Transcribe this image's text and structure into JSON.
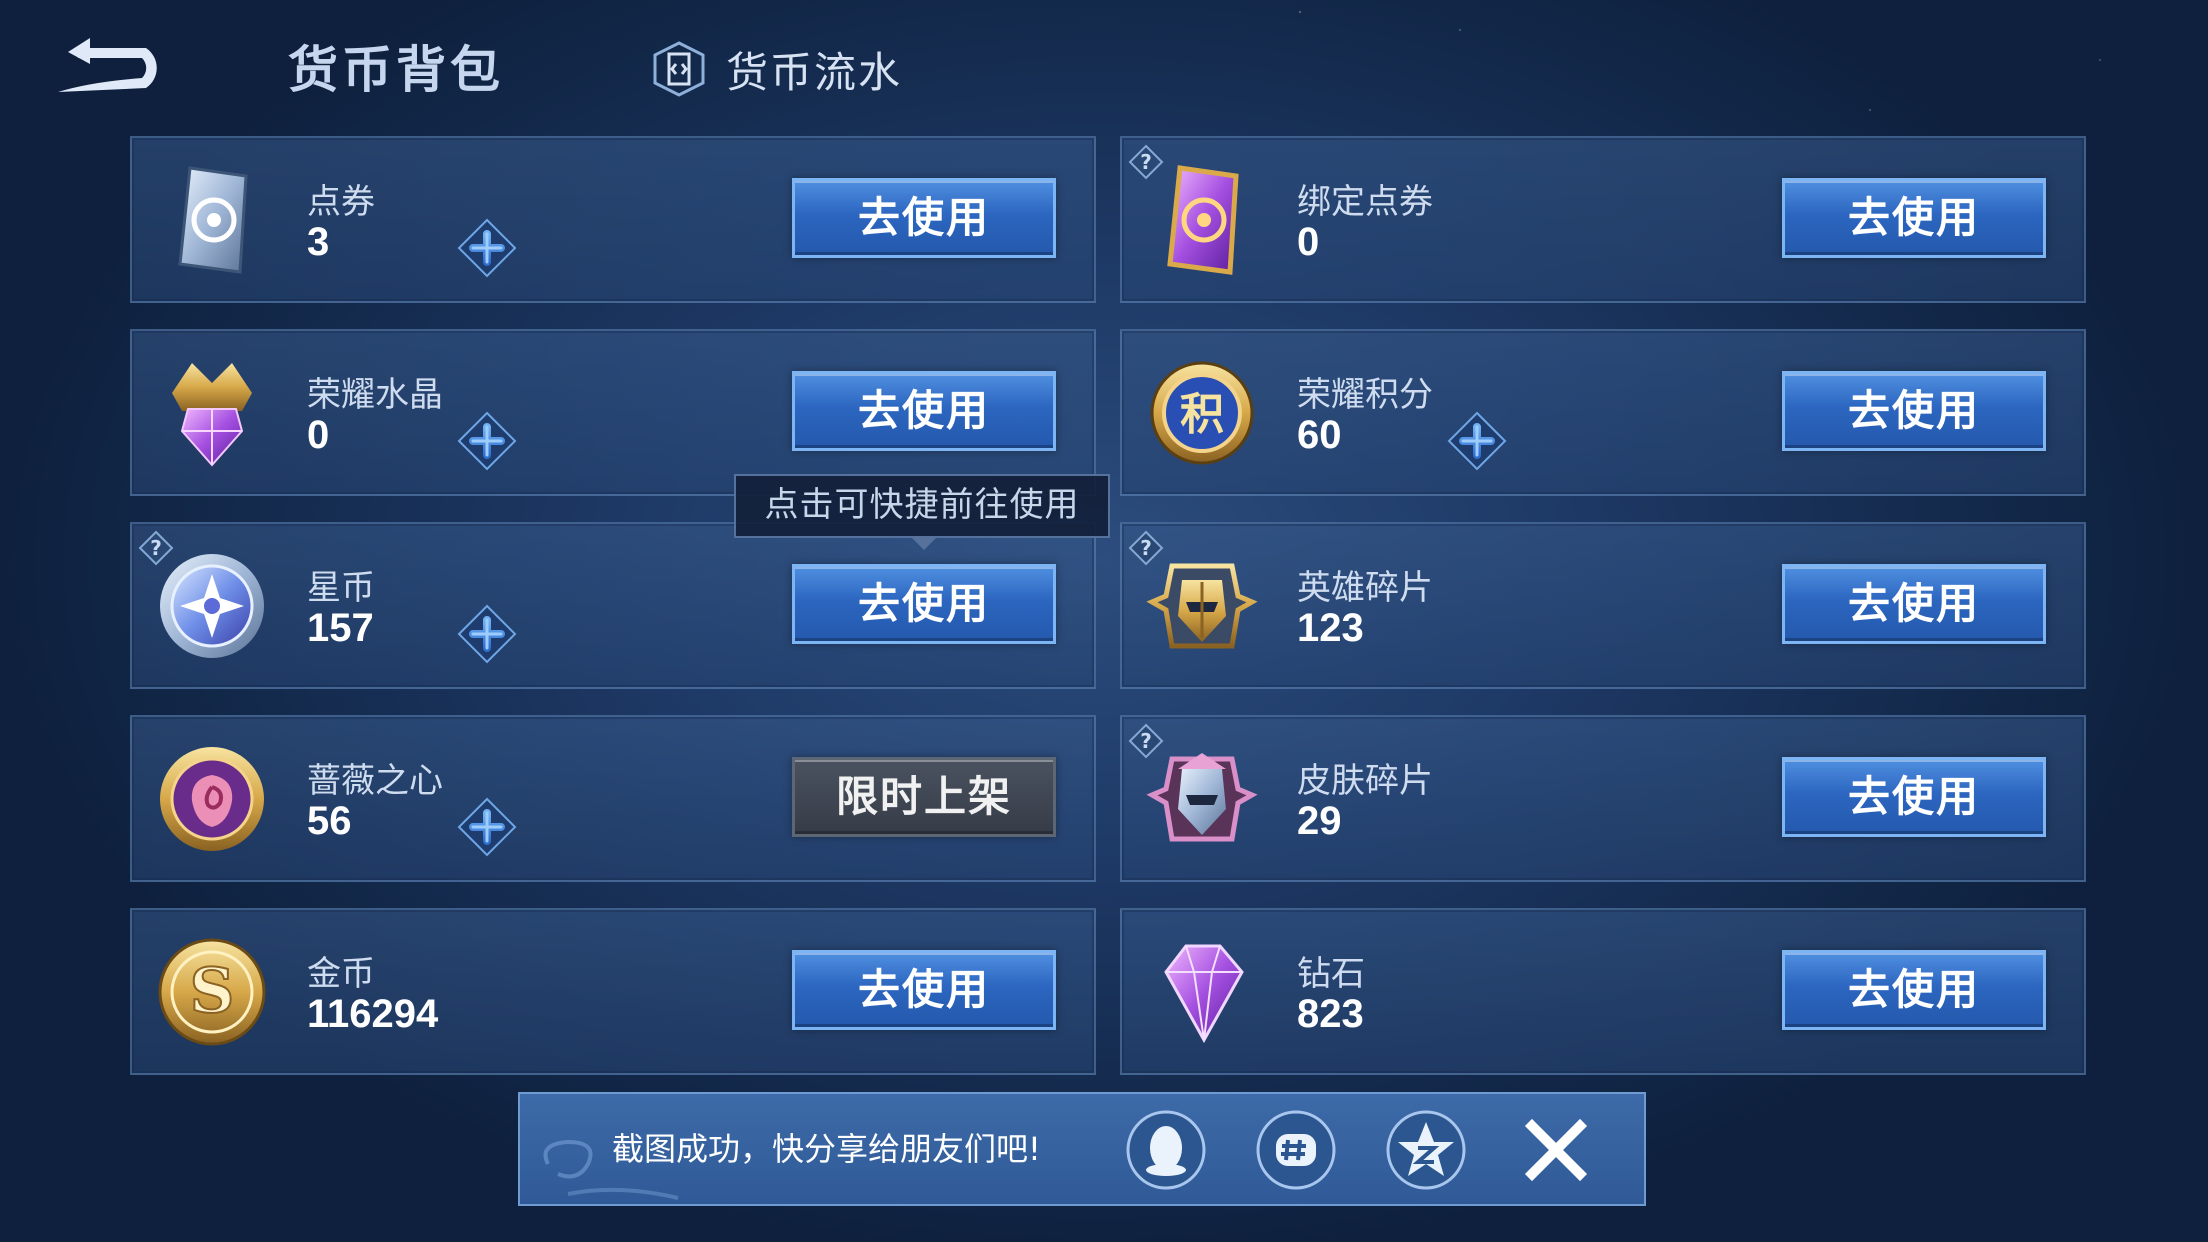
{
  "header": {
    "title": "货币背包",
    "flow_tab": "货币流水"
  },
  "cards": [
    {
      "name": "点券",
      "count": "3",
      "button": "去使用",
      "icon": "coupon-icon",
      "has_plus": true,
      "has_help": false
    },
    {
      "name": "绑定点券",
      "count": "0",
      "button": "去使用",
      "icon": "bound-coupon-icon",
      "has_plus": false,
      "has_help": true
    },
    {
      "name": "荣耀水晶",
      "count": "0",
      "button": "去使用",
      "icon": "glory-crystal-icon",
      "has_plus": true,
      "has_help": false
    },
    {
      "name": "荣耀积分",
      "count": "60",
      "button": "去使用",
      "icon": "glory-points-icon",
      "has_plus": true,
      "has_help": false
    },
    {
      "name": "星币",
      "count": "157",
      "button": "去使用",
      "icon": "star-coin-icon",
      "has_plus": true,
      "has_help": true
    },
    {
      "name": "英雄碎片",
      "count": "123",
      "button": "去使用",
      "icon": "hero-fragment-icon",
      "has_plus": false,
      "has_help": true
    },
    {
      "name": "蔷薇之心",
      "count": "56",
      "button": "限时上架",
      "icon": "rose-heart-icon",
      "has_plus": true,
      "has_help": false
    },
    {
      "name": "皮肤碎片",
      "count": "29",
      "button": "去使用",
      "icon": "skin-fragment-icon",
      "has_plus": false,
      "has_help": true
    },
    {
      "name": "金币",
      "count": "116294",
      "button": "去使用",
      "icon": "gold-coin-icon",
      "has_plus": false,
      "has_help": false
    },
    {
      "name": "钻石",
      "count": "823",
      "button": "去使用",
      "icon": "diamond-icon",
      "has_plus": false,
      "has_help": false
    }
  ],
  "tooltip": "点击可快捷前往使用",
  "share": {
    "message": "截图成功，快分享给朋友们吧!",
    "buttons": [
      "qq-icon",
      "wechat-moments-icon",
      "qzone-icon",
      "close-icon"
    ]
  },
  "colors": {
    "use_button": "#2c66c0",
    "limited_button": "#3a414c",
    "plus": "#5fa3f0"
  }
}
